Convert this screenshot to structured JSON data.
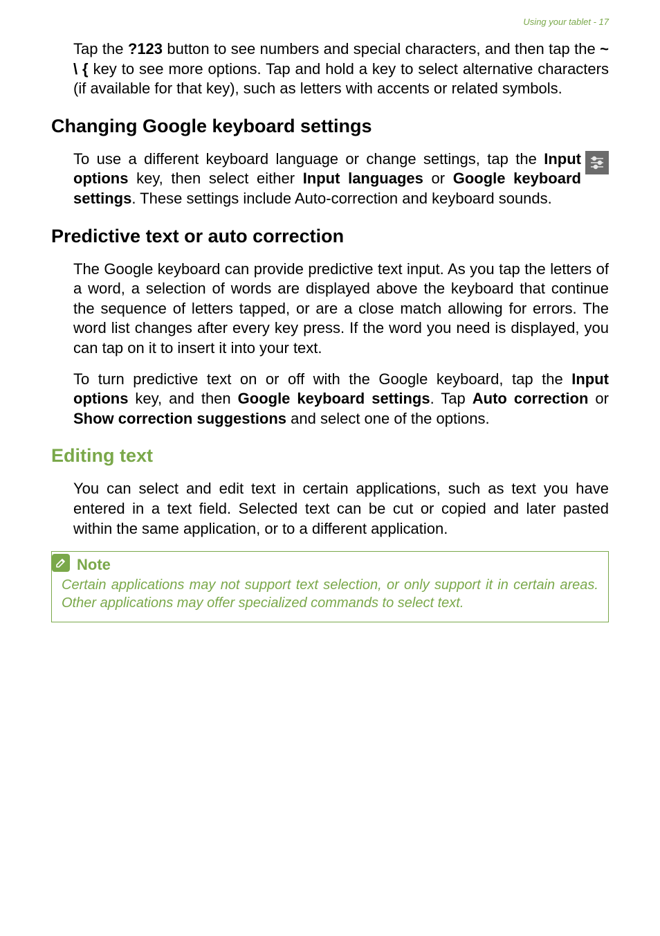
{
  "header": {
    "right": "Using your tablet - 17"
  },
  "intro": {
    "p1_a": "Tap the ",
    "p1_b": "?123",
    "p1_c": " button to see numbers and special characters, and then tap the ",
    "p1_d": "~ \\ {",
    "p1_e": " key to see more options. Tap and hold a key to select alternative characters (if available for that key), such as letters with accents or related symbols."
  },
  "s1": {
    "title": "Changing Google keyboard settings",
    "p1_a": "To use a different keyboard language or change settings, tap the ",
    "p1_b": "Input options",
    "p1_c": " key, then select either ",
    "p1_d": "Input languages",
    "p1_e": " or ",
    "p1_f": "Google keyboard settings",
    "p1_g": ". These settings include Auto-correction and keyboard sounds."
  },
  "s2": {
    "title": "Predictive text or auto correction",
    "p1": "The Google keyboard can provide predictive text input. As you tap the letters of a word, a selection of words are displayed above the keyboard that continue the sequence of letters tapped, or are a close match allowing for errors. The word list changes after every key press. If the word you need is displayed, you can tap on it to insert it into your text.",
    "p2_a": "To turn predictive text on or off with the Google keyboard, tap the ",
    "p2_b": "Input options",
    "p2_c": " key, and then ",
    "p2_d": "Google keyboard settings",
    "p2_e": ". Tap ",
    "p2_f": "Auto correction",
    "p2_g": " or ",
    "p2_h": "Show correction suggestions",
    "p2_i": " and select one of the options."
  },
  "s3": {
    "title": "Editing text",
    "p1": "You can select and edit text in certain applications, such as text you have entered in a text field. Selected text can be cut or copied and later pasted within the same application, or to a different application."
  },
  "note": {
    "title": "Note",
    "body": "Certain applications may not support text selection, or only support it in certain areas. Other applications may offer specialized commands to select text."
  }
}
